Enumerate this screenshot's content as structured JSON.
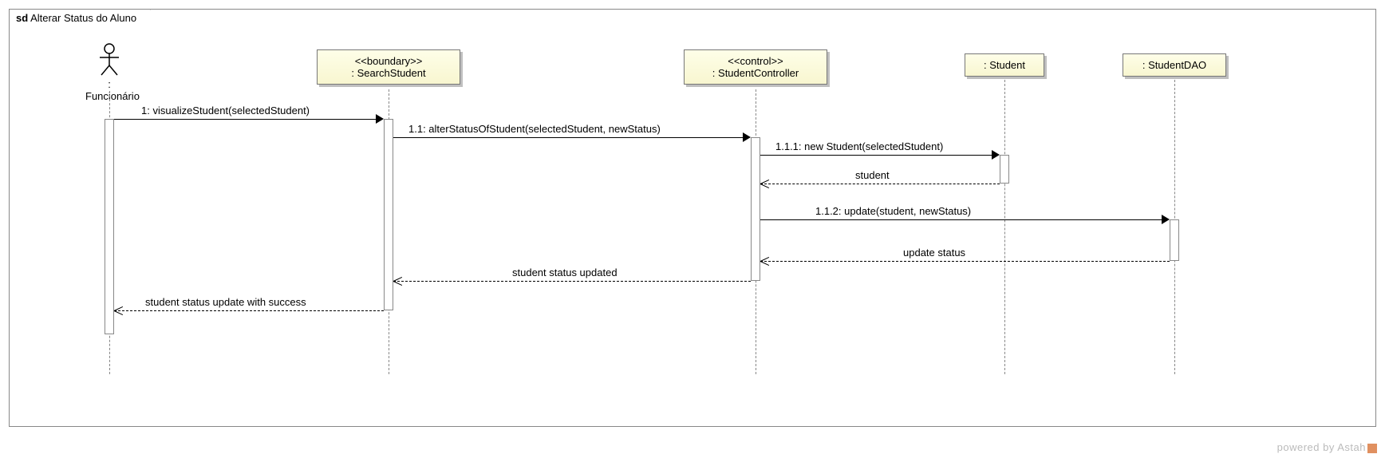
{
  "frame": {
    "prefix": "sd",
    "title": "Alterar Status do Aluno"
  },
  "participants": {
    "funcionario": {
      "label": ": Funcionário"
    },
    "search": {
      "stereotype": "<<boundary>>",
      "label": ": SearchStudent"
    },
    "controller": {
      "stereotype": "<<control>>",
      "label": ": StudentController"
    },
    "student": {
      "label": ": Student"
    },
    "dao": {
      "label": ": StudentDAO"
    }
  },
  "messages": {
    "m1": "1: visualizeStudent(selectedStudent)",
    "m11": "1.1: alterStatusOfStudent(selectedStudent, newStatus)",
    "m111": "1.1.1: new Student(selectedStudent)",
    "r111": "student",
    "m112": "1.1.2: update(student, newStatus)",
    "r112": "update status",
    "r11": "student status updated",
    "r1": "student status update with success"
  },
  "watermark": "powered by Astah",
  "chart_data": {
    "type": "sequence_diagram",
    "title": "sd Alterar Status do Aluno",
    "participants": [
      {
        "id": "funcionario",
        "name": ": Funcionário",
        "kind": "actor"
      },
      {
        "id": "search",
        "name": ": SearchStudent",
        "stereotype": "boundary"
      },
      {
        "id": "controller",
        "name": ": StudentController",
        "stereotype": "control"
      },
      {
        "id": "student",
        "name": ": Student"
      },
      {
        "id": "dao",
        "name": ": StudentDAO"
      }
    ],
    "messages": [
      {
        "seq": "1",
        "from": "funcionario",
        "to": "search",
        "label": "visualizeStudent(selectedStudent)",
        "type": "sync"
      },
      {
        "seq": "1.1",
        "from": "search",
        "to": "controller",
        "label": "alterStatusOfStudent(selectedStudent, newStatus)",
        "type": "sync"
      },
      {
        "seq": "1.1.1",
        "from": "controller",
        "to": "student",
        "label": "new Student(selectedStudent)",
        "type": "sync"
      },
      {
        "seq": "",
        "from": "student",
        "to": "controller",
        "label": "student",
        "type": "return"
      },
      {
        "seq": "1.1.2",
        "from": "controller",
        "to": "dao",
        "label": "update(student, newStatus)",
        "type": "sync"
      },
      {
        "seq": "",
        "from": "dao",
        "to": "controller",
        "label": "update status",
        "type": "return"
      },
      {
        "seq": "",
        "from": "controller",
        "to": "search",
        "label": "student status updated",
        "type": "return"
      },
      {
        "seq": "",
        "from": "search",
        "to": "funcionario",
        "label": "student status update with success",
        "type": "return"
      }
    ]
  }
}
